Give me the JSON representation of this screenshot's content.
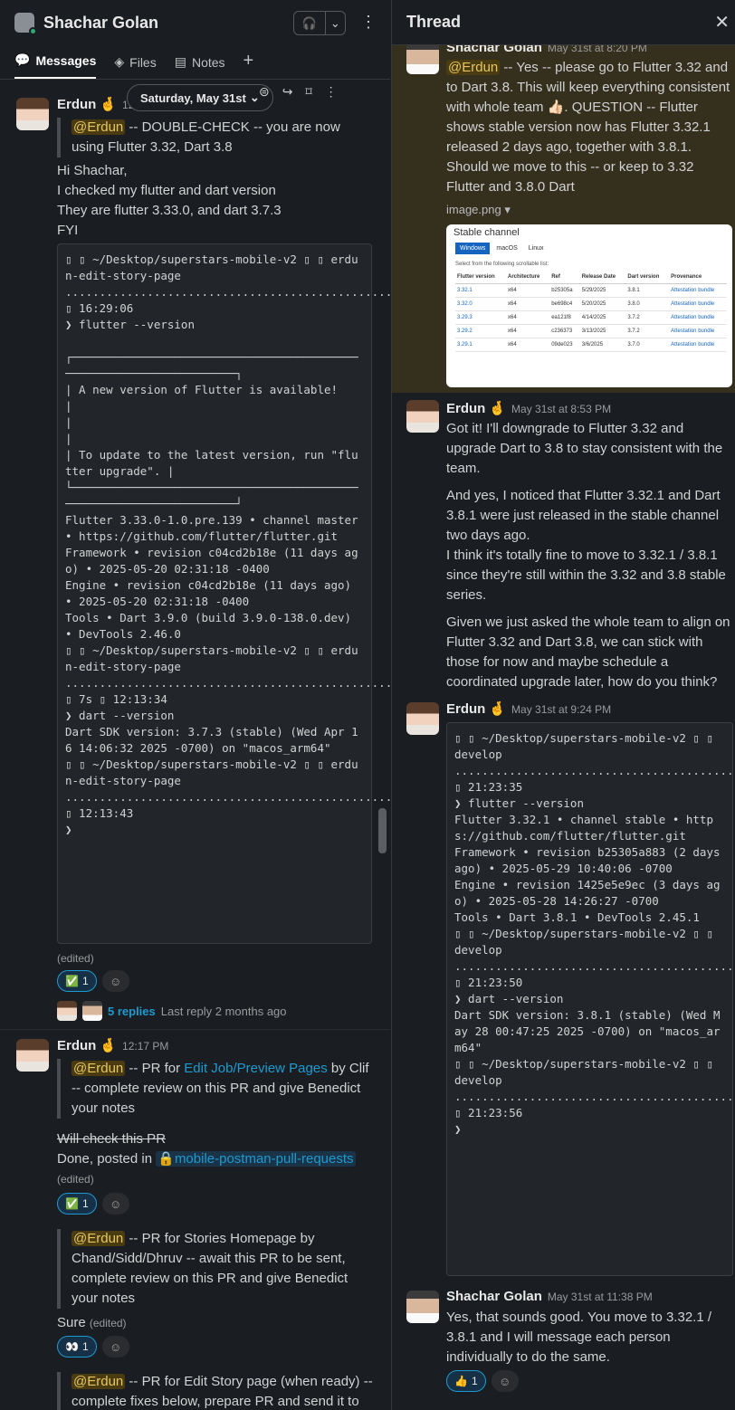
{
  "header": {
    "title": "Shachar Golan"
  },
  "tabs": [
    {
      "label": "Messages"
    },
    {
      "label": "Files"
    },
    {
      "label": "Notes"
    }
  ],
  "date_pill": "Saturday, May 31st",
  "left": {
    "msg1": {
      "author": "Erdun",
      "emoji": "🤞",
      "time": "12",
      "mention": "@Erdun",
      "quote": " -- DOUBLE-CHECK -- you are now using Flutter 3.32, Dart 3.8",
      "lines": [
        "Hi Shachar,",
        "I checked my flutter and dart version",
        "They are flutter 3.33.0, and dart 3.7.3",
        "FYI"
      ],
      "code": "▯ ▯ ~/Desktop/superstars-mobile-v2 ▯ ▯ erdun-edit-story-page ...................................................................................................................................................................... ▯ 16:29:06\n❯ flutter --version\n\n┌───────────────────────────────────────────────────────────────────┐\n| A new version of Flutter is available!\n|\n|\n|\n| To update to the latest version, run \"flutter upgrade\". |\n└───────────────────────────────────────────────────────────────────┘\nFlutter 3.33.0-1.0.pre.139 • channel master • https://github.com/flutter/flutter.git\nFramework • revision c04cd2b18e (11 days ago) • 2025-05-20 02:31:18 -0400\nEngine • revision c04cd2b18e (11 days ago) • 2025-05-20 02:31:18 -0400\nTools • Dart 3.9.0 (build 3.9.0-138.0.dev) • DevTools 2.46.0\n▯ ▯ ~/Desktop/superstars-mobile-v2 ▯ ▯ erdun-edit-story-page ......................................................................................................................................................... ▯ 7s ▯ 12:13:34\n❯ dart --version\nDart SDK version: 3.7.3 (stable) (Wed Apr 16 14:06:32 2025 -0700) on \"macos_arm64\"\n▯ ▯ ~/Desktop/superstars-mobile-v2 ▯ ▯ erdun-edit-story-page ...................................................................................................................................................................... ▯ 12:13:43\n❯",
      "edited": "(edited)",
      "reaction": {
        "emoji": "✅",
        "count": "1"
      },
      "replies": "5 replies",
      "last_reply": "Last reply 2 months ago"
    },
    "msg2": {
      "author": "Erdun",
      "emoji": "🤞",
      "time": "12:17 PM",
      "q1_mention": "@Erdun",
      "q1_a": " -- PR for ",
      "q1_link": "Edit Job/Preview Pages",
      "q1_b": " by Clif -- complete review on this PR and give Benedict your notes",
      "strike": "Will check this PR",
      "done": "Done, posted in ",
      "channel": "mobile-postman-pull-requests",
      "edited": "(edited)",
      "reaction1": {
        "emoji": "✅",
        "count": "1"
      },
      "q2_mention": "@Erdun",
      "q2_text": " -- PR for Stories Homepage by Chand/Sidd/Dhruv -- await this PR to be sent, complete review on this PR and give Benedict your notes",
      "sure": "Sure",
      "sure_edited": "(edited)",
      "reaction2": {
        "emoji": "👀",
        "count": "1"
      },
      "q3_mention": "@Erdun",
      "q3_text": " -- PR for Edit Story page (when ready) -- complete fixes below, prepare PR and send it to"
    }
  },
  "thread": {
    "title": "Thread",
    "p1": {
      "author": "Shachar Golan",
      "time": "May 31st at 8:20 PM",
      "mention": "@Erdun",
      "text": " -- Yes -- please go to Flutter 3.32 and to Dart 3.8. This will keep everything consistent with whole team 👍🏻. QUESTION -- Flutter shows stable version now has Flutter 3.32.1 released 2 days ago, together with 3.8.1. Should we move to this -- or keep to 3.32 Flutter and 3.8.0 Dart",
      "attachment": "image.png",
      "image": {
        "title": "Stable channel",
        "tabs": [
          "Windows",
          "macOS",
          "Linux"
        ],
        "caption": "Select from the following scrollable list:",
        "headers": [
          "Flutter version",
          "Architecture",
          "Ref",
          "Release Date",
          "Dart version",
          "Provenance"
        ],
        "rows": [
          [
            "3.32.1",
            "x64",
            "b25305a",
            "5/29/2025",
            "3.8.1",
            "Attestation bundle"
          ],
          [
            "3.32.0",
            "x64",
            "be698c4",
            "5/20/2025",
            "3.8.0",
            "Attestation bundle"
          ],
          [
            "3.29.3",
            "x64",
            "ea121f8",
            "4/14/2025",
            "3.7.2",
            "Attestation bundle"
          ],
          [
            "3.29.2",
            "x64",
            "c236373",
            "3/13/2025",
            "3.7.2",
            "Attestation bundle"
          ],
          [
            "3.29.1",
            "x64",
            "09de023",
            "3/6/2025",
            "3.7.0",
            "Attestation bundle"
          ]
        ]
      }
    },
    "p2": {
      "author": "Erdun",
      "emoji": "🤞",
      "time": "May 31st at 8:53 PM",
      "para1": "Got it! I'll downgrade to Flutter 3.32 and upgrade Dart to 3.8 to stay consistent with the team.",
      "para2": "And yes, I noticed that Flutter 3.32.1 and Dart 3.8.1 were just released in the stable channel two days ago.",
      "para3": "I think it's totally fine to move to 3.32.1 / 3.8.1 since they're still within the 3.32 and 3.8 stable series.",
      "para4": "Given we just asked the whole team to align on Flutter 3.32 and Dart 3.8, we can stick with those for now and maybe schedule a coordinated upgrade later, how do you think?"
    },
    "p3": {
      "author": "Erdun",
      "emoji": "🤞",
      "time": "May 31st at 9:24 PM",
      "code": "▯ ▯ ~/Desktop/superstars-mobile-v2 ▯ ▯ develop ....................................................................................................................................... ▯ 21:23:35\n❯ flutter --version\nFlutter 3.32.1 • channel stable • https://github.com/flutter/flutter.git\nFramework • revision b25305a883 (2 days ago) • 2025-05-29 10:40:06 -0700\nEngine • revision 1425e5e9ec (3 days ago) • 2025-05-28 14:26:27 -0700\nTools • Dart 3.8.1 • DevTools 2.45.1\n▯ ▯ ~/Desktop/superstars-mobile-v2 ▯ ▯ develop ....................................................................................................................................... ▯ 21:23:50\n❯ dart --version\nDart SDK version: 3.8.1 (stable) (Wed May 28 00:47:25 2025 -0700) on \"macos_arm64\"\n▯ ▯ ~/Desktop/superstars-mobile-v2 ▯ ▯ develop ....................................................................................................................................... ▯ 21:23:56\n❯"
    },
    "p4": {
      "author": "Shachar Golan",
      "time": "May 31st at 11:38 PM",
      "text": "Yes, that sounds good. You move to 3.32.1 / 3.8.1 and I will message each person individually to do the same.",
      "reaction": {
        "emoji": "👍",
        "count": "1"
      }
    }
  }
}
